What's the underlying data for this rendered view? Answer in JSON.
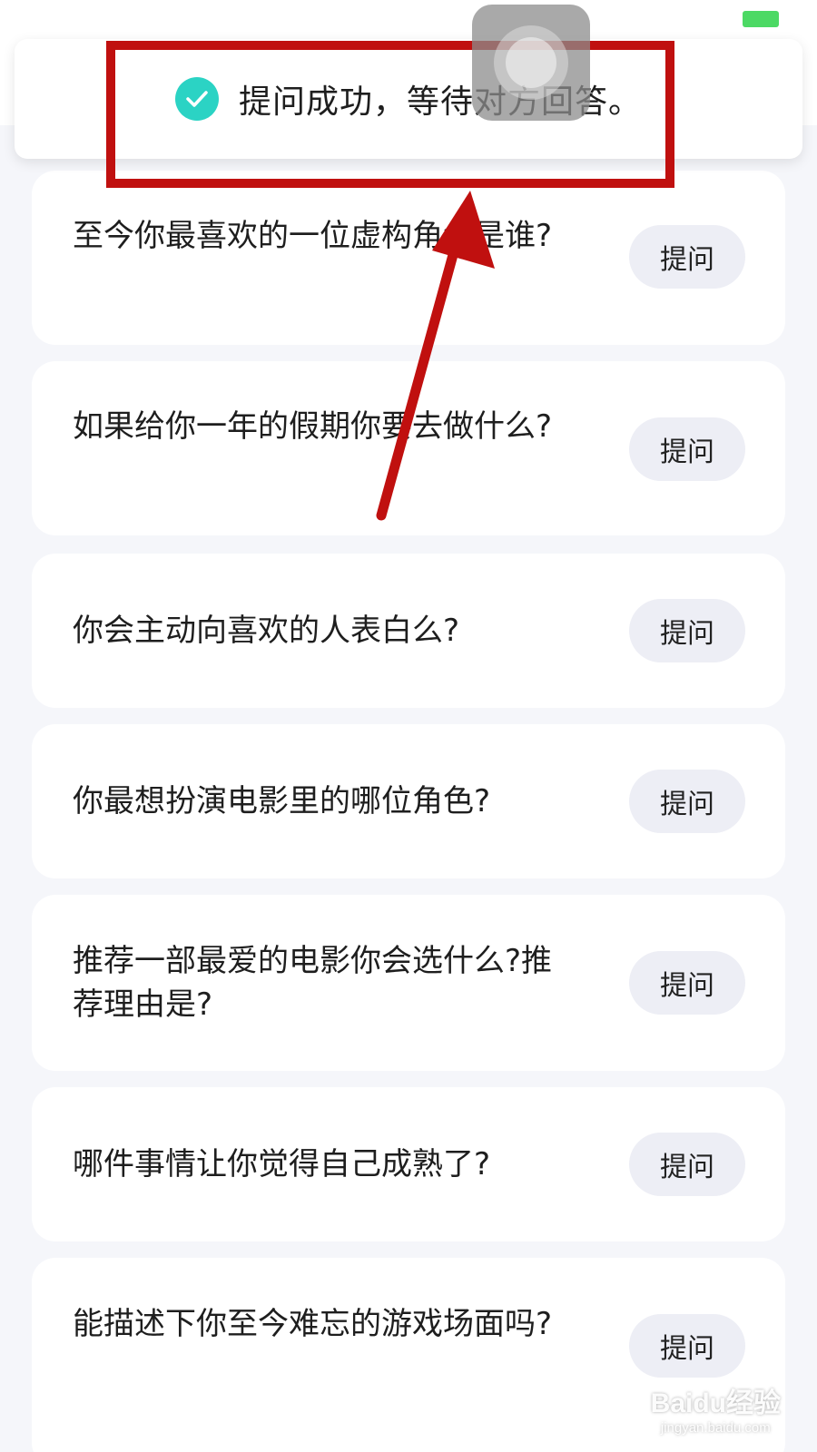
{
  "toast": {
    "message": "提问成功，等待对方回答。",
    "icon": "check-circle-icon",
    "icon_color": "#2bd3c4"
  },
  "questions": [
    {
      "text": "至今你最喜欢的一位虚构角色是谁?",
      "button": "提问"
    },
    {
      "text": "如果给你一年的假期你要去做什么?",
      "button": "提问"
    },
    {
      "text": "你会主动向喜欢的人表白么?",
      "button": "提问"
    },
    {
      "text": "你最想扮演电影里的哪位角色?",
      "button": "提问"
    },
    {
      "text": "推荐一部最爱的电影你会选什么?推荐理由是?",
      "button": "提问"
    },
    {
      "text": "哪件事情让你觉得自己成熟了?",
      "button": "提问"
    },
    {
      "text": "能描述下你至今难忘的游戏场面吗?",
      "button": "提问"
    }
  ],
  "annotation": {
    "color": "#c0100f"
  },
  "watermark": {
    "brand": "Baidu经验",
    "url": "jingyan.baidu.com"
  }
}
